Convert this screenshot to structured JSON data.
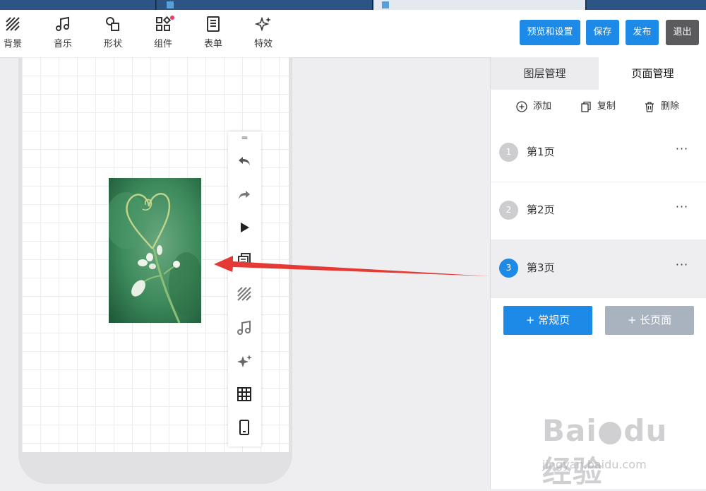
{
  "toolbar": {
    "tools": [
      "背景",
      "音乐",
      "形状",
      "组件",
      "表单",
      "特效"
    ],
    "buttons": {
      "preview": "预览和设置",
      "save": "保存",
      "publish": "发布",
      "exit": "退出"
    }
  },
  "panel": {
    "tabs": {
      "layers": "图层管理",
      "pages": "页面管理"
    },
    "actions": {
      "add": "添加",
      "copy": "复制",
      "delete": "删除"
    },
    "pages": [
      {
        "num": "1",
        "name": "第1页"
      },
      {
        "num": "2",
        "name": "第2页"
      },
      {
        "num": "3",
        "name": "第3页"
      }
    ],
    "more": "···",
    "add_regular": "+ 常规页",
    "add_long": "+ 长页面"
  },
  "canvas": {
    "toolbar_handle": "="
  },
  "watermark": {
    "brand": "Bai",
    "brand2": "du",
    "cn": "经验",
    "url": "jingyan.baidu.com"
  },
  "colors": {
    "primary": "#1e8ae8",
    "exit": "#5b5b5d",
    "disabled": "#a8b3bf",
    "arrow": "#e53935",
    "notify": "#f03a5c"
  }
}
